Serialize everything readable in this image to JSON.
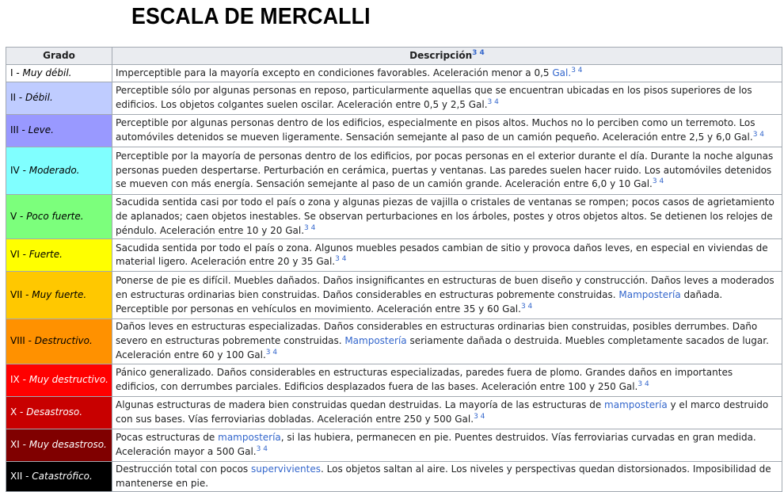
{
  "title": "ESCALA DE MERCALLI",
  "table": {
    "headers": {
      "grade": "Grado",
      "description": "Descripción",
      "description_refs": "3 4"
    },
    "rows": [
      {
        "numeral": "I",
        "name": "Muy débil.",
        "bg": "#ffffff",
        "fg": "#000000",
        "parts": [
          {
            "t": "Imperceptible para la mayoría excepto en condiciones favorables. Aceleración menor a 0,5 "
          },
          {
            "t": "Gal.",
            "link": true
          },
          {
            "t": "3 4",
            "sup": true
          }
        ]
      },
      {
        "numeral": "II",
        "name": "Débil.",
        "bg": "#bfccff",
        "fg": "#000000",
        "parts": [
          {
            "t": "Perceptible sólo por algunas personas en reposo, particularmente aquellas que se encuentran ubicadas en los pisos superiores de los edificios. Los objetos colgantes suelen oscilar. Aceleración entre 0,5 y 2,5 Gal."
          },
          {
            "t": "3 4",
            "sup": true
          }
        ]
      },
      {
        "numeral": "III",
        "name": "Leve.",
        "bg": "#9999ff",
        "fg": "#000000",
        "parts": [
          {
            "t": "Perceptible por algunas personas dentro de los edificios, especialmente en pisos altos. Muchos no lo perciben como un terremoto. Los automóviles detenidos se mueven ligeramente. Sensación semejante al paso de un camión pequeño. Aceleración entre 2,5 y 6,0 Gal."
          },
          {
            "t": "3 4",
            "sup": true
          }
        ]
      },
      {
        "numeral": "IV",
        "name": "Moderado.",
        "bg": "#80ffff",
        "fg": "#000000",
        "parts": [
          {
            "t": "Perceptible por la mayoría de personas dentro de los edificios, por pocas personas en el exterior durante el día. Durante la noche algunas personas pueden despertarse. Perturbación en cerámica, puertas y ventanas. Las paredes suelen hacer ruido. Los automóviles detenidos se mueven con más energía. Sensación semejante al paso de un camión grande. Aceleración entre 6,0 y 10 Gal."
          },
          {
            "t": "3 4",
            "sup": true
          }
        ]
      },
      {
        "numeral": "V",
        "name": "Poco fuerte.",
        "bg": "#7cff7c",
        "fg": "#000000",
        "parts": [
          {
            "t": "Sacudida sentida casi por todo el país o zona y algunas piezas de vajilla o cristales de ventanas se rompen; pocos casos de agrietamiento de aplanados; caen objetos inestables. Se observan perturbaciones en los árboles, postes y otros objetos altos. Se detienen los relojes de péndulo. Aceleración entre 10 y 20 Gal."
          },
          {
            "t": "3 4",
            "sup": true
          }
        ]
      },
      {
        "numeral": "VI",
        "name": "Fuerte.",
        "bg": "#ffff00",
        "fg": "#000000",
        "parts": [
          {
            "t": "Sacudida sentida por todo el país o zona. Algunos muebles pesados cambian de sitio y provoca daños leves, en especial en viviendas de material ligero. Aceleración entre 20 y 35 Gal."
          },
          {
            "t": "3 4",
            "sup": true
          }
        ]
      },
      {
        "numeral": "VII",
        "name": "Muy fuerte.",
        "bg": "#ffc800",
        "fg": "#000000",
        "parts": [
          {
            "t": "Ponerse de pie es difícil. Muebles dañados. Daños insignificantes en estructuras de buen diseño y construcción. Daños leves a moderados en estructuras ordinarias bien construidas. Daños considerables en estructuras pobremente construidas. "
          },
          {
            "t": "Mampostería",
            "link": true
          },
          {
            "t": " dañada. Perceptible por personas en vehículos en movimiento. Aceleración entre 35 y 60 Gal."
          },
          {
            "t": "3 4",
            "sup": true
          }
        ]
      },
      {
        "numeral": "VIII",
        "name": "Destructivo.",
        "bg": "#ff9100",
        "fg": "#000000",
        "parts": [
          {
            "t": "Daños leves en estructuras especializadas. Daños considerables en estructuras ordinarias bien construidas, posibles derrumbes. Daño severo en estructuras pobremente construidas. "
          },
          {
            "t": "Mampostería",
            "link": true
          },
          {
            "t": " seriamente dañada o destruida. Muebles completamente sacados de lugar. Aceleración entre 60 y 100 Gal."
          },
          {
            "t": "3 4",
            "sup": true
          }
        ]
      },
      {
        "numeral": "IX",
        "name": "Muy destructivo.",
        "bg": "#ff0000",
        "fg": "#ffffff",
        "parts": [
          {
            "t": "Pánico generalizado. Daños considerables en estructuras especializadas, paredes fuera de plomo. Grandes daños en importantes edificios, con derrumbes parciales. Edificios desplazados fuera de las bases. Aceleración entre 100 y 250 Gal."
          },
          {
            "t": "3 4",
            "sup": true
          }
        ]
      },
      {
        "numeral": "X",
        "name": "Desastroso.",
        "bg": "#c80000",
        "fg": "#ffffff",
        "parts": [
          {
            "t": "Algunas estructuras de madera bien construidas quedan destruidas. La mayoría de las estructuras de "
          },
          {
            "t": "mampostería",
            "link": true
          },
          {
            "t": " y el marco destruido con sus bases. Vías ferroviarias dobladas. Aceleración entre 250 y 500 Gal."
          },
          {
            "t": "3 4",
            "sup": true
          }
        ]
      },
      {
        "numeral": "XI",
        "name": "Muy desastroso.",
        "bg": "#800000",
        "fg": "#ffffff",
        "parts": [
          {
            "t": "Pocas estructuras de "
          },
          {
            "t": "mampostería",
            "link": true
          },
          {
            "t": ", si las hubiera, permanecen en pie. Puentes destruidos. Vías ferroviarias curvadas en gran medida. Aceleración mayor a 500 Gal."
          },
          {
            "t": "3 4",
            "sup": true
          }
        ]
      },
      {
        "numeral": "XII",
        "name": "Catastrófico.",
        "bg": "#000000",
        "fg": "#ffffff",
        "parts": [
          {
            "t": "Destrucción total con pocos "
          },
          {
            "t": "supervivientes",
            "link": true
          },
          {
            "t": ". Los objetos saltan al aire. Los niveles y perspectivas quedan distorsionados. Imposibilidad de mantenerse en pie."
          }
        ]
      }
    ]
  }
}
